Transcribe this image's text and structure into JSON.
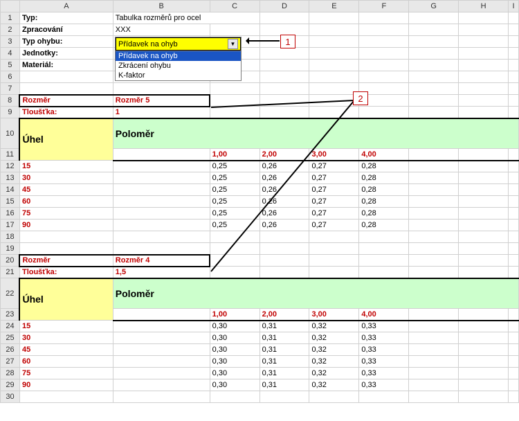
{
  "cols": [
    "A",
    "B",
    "C",
    "D",
    "E",
    "F",
    "G",
    "H",
    "I"
  ],
  "labels": {
    "typ": "Typ:",
    "zpracovani": "Zpracování",
    "typ_ohybu": "Typ ohybu:",
    "jednotky": "Jednotky:",
    "material": "Materiál:",
    "typ_val": "Tabulka rozměrů pro ocel",
    "zprac_val": "XXX",
    "rozmer": "Rozměr",
    "rozmer5": "Rozměr 5",
    "rozmer4": "Rozměr 4",
    "tloustka": "Tloušťka:",
    "t1": "1",
    "t15": "1,5",
    "uhel": "Úhel",
    "polomer": "Poloměr"
  },
  "dropdown": {
    "selected": "Přídavek na ohyb",
    "options": [
      "Přídavek na ohyb",
      "Zkrácení ohybu",
      "K-faktor"
    ],
    "highlighted": "Přídavek na ohyb"
  },
  "callouts": {
    "c1": "1",
    "c2": "2"
  },
  "chart_data": {
    "type": "table",
    "tables": [
      {
        "name": "Rozměr 5",
        "thickness": 1,
        "col_header": "Poloměr",
        "row_header": "Úhel",
        "radii": [
          1.0,
          2.0,
          3.0,
          4.0
        ],
        "angles": [
          15,
          30,
          45,
          60,
          75,
          90
        ],
        "values": [
          [
            0.25,
            0.26,
            0.27,
            0.28
          ],
          [
            0.25,
            0.26,
            0.27,
            0.28
          ],
          [
            0.25,
            0.26,
            0.27,
            0.28
          ],
          [
            0.25,
            0.26,
            0.27,
            0.28
          ],
          [
            0.25,
            0.26,
            0.27,
            0.28
          ],
          [
            0.25,
            0.26,
            0.27,
            0.28
          ]
        ]
      },
      {
        "name": "Rozměr 4",
        "thickness": 1.5,
        "col_header": "Poloměr",
        "row_header": "Úhel",
        "radii": [
          1.0,
          2.0,
          3.0,
          4.0
        ],
        "angles": [
          15,
          30,
          45,
          60,
          75,
          90
        ],
        "values": [
          [
            0.3,
            0.31,
            0.32,
            0.33
          ],
          [
            0.3,
            0.31,
            0.32,
            0.33
          ],
          [
            0.3,
            0.31,
            0.32,
            0.33
          ],
          [
            0.3,
            0.31,
            0.32,
            0.33
          ],
          [
            0.3,
            0.31,
            0.32,
            0.33
          ],
          [
            0.3,
            0.31,
            0.32,
            0.33
          ]
        ]
      }
    ]
  },
  "radii_fmt": [
    "1,00",
    "2,00",
    "3,00",
    "4,00"
  ],
  "t1_vals": {
    "r": [
      "15",
      "30",
      "45",
      "60",
      "75",
      "90"
    ],
    "c": [
      [
        "0,25",
        "0,26",
        "0,27",
        "0,28"
      ],
      [
        "0,25",
        "0,26",
        "0,27",
        "0,28"
      ],
      [
        "0,25",
        "0,26",
        "0,27",
        "0,28"
      ],
      [
        "0,25",
        "0,26",
        "0,27",
        "0,28"
      ],
      [
        "0,25",
        "0,26",
        "0,27",
        "0,28"
      ],
      [
        "0,25",
        "0,26",
        "0,27",
        "0,28"
      ]
    ]
  },
  "t2_vals": {
    "r": [
      "15",
      "30",
      "45",
      "60",
      "75",
      "90"
    ],
    "c": [
      [
        "0,30",
        "0,31",
        "0,32",
        "0,33"
      ],
      [
        "0,30",
        "0,31",
        "0,32",
        "0,33"
      ],
      [
        "0,30",
        "0,31",
        "0,32",
        "0,33"
      ],
      [
        "0,30",
        "0,31",
        "0,32",
        "0,33"
      ],
      [
        "0,30",
        "0,31",
        "0,32",
        "0,33"
      ],
      [
        "0,30",
        "0,31",
        "0,32",
        "0,33"
      ]
    ]
  }
}
